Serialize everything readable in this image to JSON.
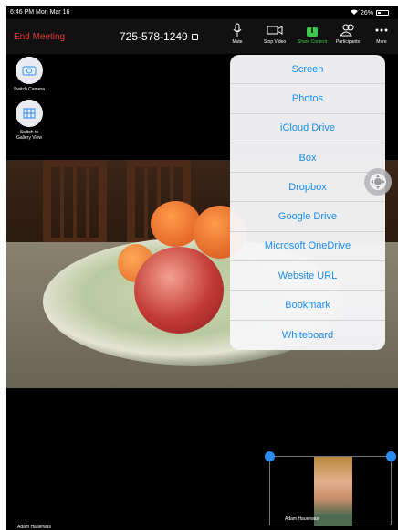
{
  "status_bar": {
    "time": "6:46 PM  Mon Mar 16",
    "battery": "26%"
  },
  "toolbar": {
    "end_meeting": "End Meeting",
    "meeting_id": "725-578-1249",
    "buttons": [
      {
        "label": "Mute",
        "icon": "microphone-icon"
      },
      {
        "label": "Stop Video",
        "icon": "video-camera-icon"
      },
      {
        "label": "Share Content",
        "icon": "share-icon",
        "color": "#3ec84a"
      },
      {
        "label": "Participants",
        "icon": "participants-icon"
      },
      {
        "label": "More",
        "icon": "more-icon"
      }
    ]
  },
  "side_buttons": [
    {
      "label": "Switch Camera",
      "icon": "switch-camera-icon"
    },
    {
      "label": "Switch to Gallery View",
      "icon": "gallery-view-icon"
    }
  ],
  "share_menu": {
    "items": [
      "Screen",
      "Photos",
      "iCloud Drive",
      "Box",
      "Dropbox",
      "Google Drive",
      "Microsoft OneDrive",
      "Website URL",
      "Bookmark",
      "Whiteboard"
    ]
  },
  "self_view": {
    "name": "Adam Hauerwas"
  },
  "active_speaker": {
    "name": "Adam Hauerwas"
  },
  "colors": {
    "end_meeting": "#e53935",
    "menu_text": "#1a8cf0",
    "share_active": "#3ec84a"
  }
}
